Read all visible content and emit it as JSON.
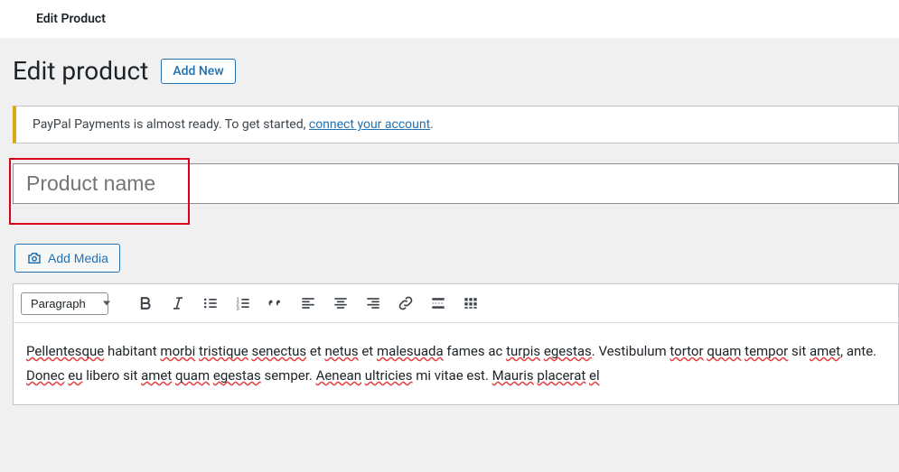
{
  "header": {
    "title": "Edit Product"
  },
  "page": {
    "title": "Edit product",
    "add_new_label": "Add New"
  },
  "notice": {
    "text_before": "PayPal Payments is almost ready. To get started, ",
    "link_text": "connect your account",
    "text_after": "."
  },
  "title_input": {
    "placeholder": "Product name",
    "value": ""
  },
  "media_button": {
    "label": "Add Media"
  },
  "toolbar": {
    "format_select": "Paragraph",
    "buttons": {
      "bold": "Bold",
      "italic": "Italic",
      "ul": "Bulleted list",
      "ol": "Numbered list",
      "quote": "Blockquote",
      "alignleft": "Align left",
      "aligncenter": "Align center",
      "alignright": "Align right",
      "link": "Link",
      "more": "Insert Read More tag",
      "toggle": "Toolbar Toggle"
    }
  },
  "editor": {
    "content_parts": [
      {
        "t": "Pellentesque",
        "w": true
      },
      {
        "t": " habitant ",
        "w": false
      },
      {
        "t": "morbi",
        "w": true
      },
      {
        "t": " ",
        "w": false
      },
      {
        "t": "tristique",
        "w": true
      },
      {
        "t": " ",
        "w": false
      },
      {
        "t": "senectus",
        "w": true
      },
      {
        "t": " et ",
        "w": false
      },
      {
        "t": "netus",
        "w": true
      },
      {
        "t": " et ",
        "w": false
      },
      {
        "t": "malesuada",
        "w": true
      },
      {
        "t": " fames ac ",
        "w": false
      },
      {
        "t": "turpis",
        "w": true
      },
      {
        "t": " ",
        "w": false
      },
      {
        "t": "egestas",
        "w": true
      },
      {
        "t": ". Vestibulum ",
        "w": false
      },
      {
        "t": "tortor",
        "w": true
      },
      {
        "t": " ",
        "w": false
      },
      {
        "t": "quam",
        "w": true
      },
      {
        "t": " ",
        "w": false
      },
      {
        "t": "tempor",
        "w": true
      },
      {
        "t": " sit ",
        "w": false
      },
      {
        "t": "amet",
        "w": true
      },
      {
        "t": ", ante. ",
        "w": false
      },
      {
        "t": "Donec",
        "w": true
      },
      {
        "t": " ",
        "w": false
      },
      {
        "t": "eu",
        "w": true
      },
      {
        "t": " libero sit ",
        "w": false
      },
      {
        "t": "amet",
        "w": true
      },
      {
        "t": " ",
        "w": false
      },
      {
        "t": "quam",
        "w": true
      },
      {
        "t": " ",
        "w": false
      },
      {
        "t": "egestas",
        "w": true
      },
      {
        "t": " semper. ",
        "w": false
      },
      {
        "t": "Aenean",
        "w": true
      },
      {
        "t": " ",
        "w": false
      },
      {
        "t": "ultricies",
        "w": true
      },
      {
        "t": " mi vitae est. ",
        "w": false
      },
      {
        "t": "Mauris",
        "w": true
      },
      {
        "t": " ",
        "w": false
      },
      {
        "t": "placerat",
        "w": true
      },
      {
        "t": " ",
        "w": false
      },
      {
        "t": "el",
        "w": true
      }
    ]
  }
}
